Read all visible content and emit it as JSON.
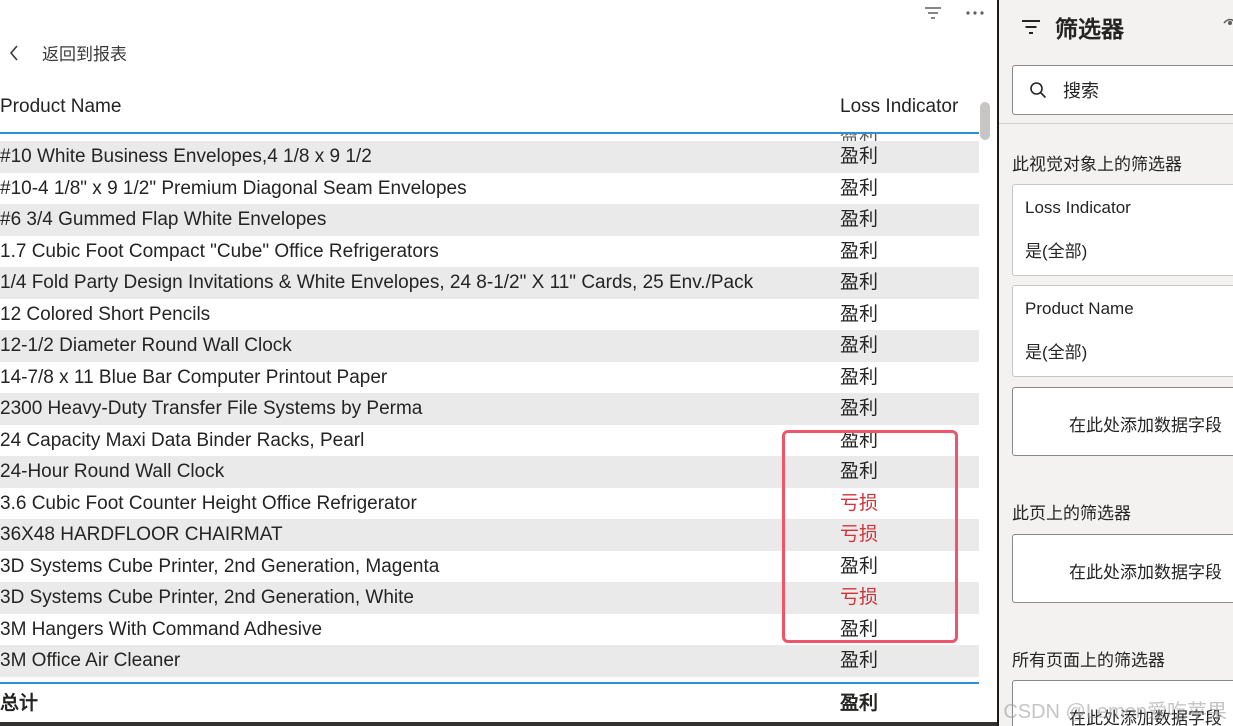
{
  "report": {
    "back_label": "返回到报表",
    "columns": [
      "Product Name",
      "Loss Indicator"
    ],
    "partial_row_indicator": "盈利",
    "rows": [
      {
        "name": "#10 White Business Envelopes,4 1/8 x 9 1/2",
        "indicator": "盈利",
        "loss": false
      },
      {
        "name": "#10-4 1/8\" x 9 1/2\" Premium Diagonal Seam Envelopes",
        "indicator": "盈利",
        "loss": false
      },
      {
        "name": "#6 3/4 Gummed Flap White Envelopes",
        "indicator": "盈利",
        "loss": false
      },
      {
        "name": "1.7 Cubic Foot Compact \"Cube\" Office Refrigerators",
        "indicator": "盈利",
        "loss": false
      },
      {
        "name": "1/4 Fold Party Design Invitations & White Envelopes, 24 8-1/2\" X 11\" Cards, 25 Env./Pack",
        "indicator": "盈利",
        "loss": false
      },
      {
        "name": "12 Colored Short Pencils",
        "indicator": "盈利",
        "loss": false
      },
      {
        "name": "12-1/2 Diameter Round Wall Clock",
        "indicator": "盈利",
        "loss": false
      },
      {
        "name": "14-7/8 x 11 Blue Bar Computer Printout Paper",
        "indicator": "盈利",
        "loss": false
      },
      {
        "name": "2300 Heavy-Duty Transfer File Systems by Perma",
        "indicator": "盈利",
        "loss": false
      },
      {
        "name": "24 Capacity Maxi Data Binder Racks, Pearl",
        "indicator": "盈利",
        "loss": false
      },
      {
        "name": "24-Hour Round Wall Clock",
        "indicator": "盈利",
        "loss": false
      },
      {
        "name": "3.6 Cubic Foot Counter Height Office Refrigerator",
        "indicator": "亏损",
        "loss": true
      },
      {
        "name": "36X48 HARDFLOOR CHAIRMAT",
        "indicator": "亏损",
        "loss": true
      },
      {
        "name": "3D Systems Cube Printer, 2nd Generation, Magenta",
        "indicator": "盈利",
        "loss": false
      },
      {
        "name": "3D Systems Cube Printer, 2nd Generation, White",
        "indicator": "亏损",
        "loss": true
      },
      {
        "name": "3M Hangers With Command Adhesive",
        "indicator": "盈利",
        "loss": false
      },
      {
        "name": "3M Office Air Cleaner",
        "indicator": "盈利",
        "loss": false
      }
    ],
    "total": {
      "label": "总计",
      "indicator": "盈利"
    }
  },
  "filters": {
    "title": "筛选器",
    "search_placeholder": "搜索",
    "visual_section": "此视觉对象上的筛选器",
    "cards": [
      {
        "title": "Loss Indicator",
        "value": "是(全部)"
      },
      {
        "title": "Product Name",
        "value": "是(全部)"
      }
    ],
    "add_field": "在此处添加数据字段",
    "page_section": "此页上的筛选器",
    "all_pages_section": "所有页面上的筛选器"
  },
  "watermark": "CSDN @Lemon爱吃苹果",
  "colors": {
    "loss": "#d13438",
    "accent_rule": "#2f8fd3",
    "highlight": "#f0546a",
    "stripe": "#eaeaea"
  },
  "icons": [
    "filter-icon",
    "more-options-icon",
    "back-chevron-icon",
    "search-icon",
    "eye-icon"
  ]
}
